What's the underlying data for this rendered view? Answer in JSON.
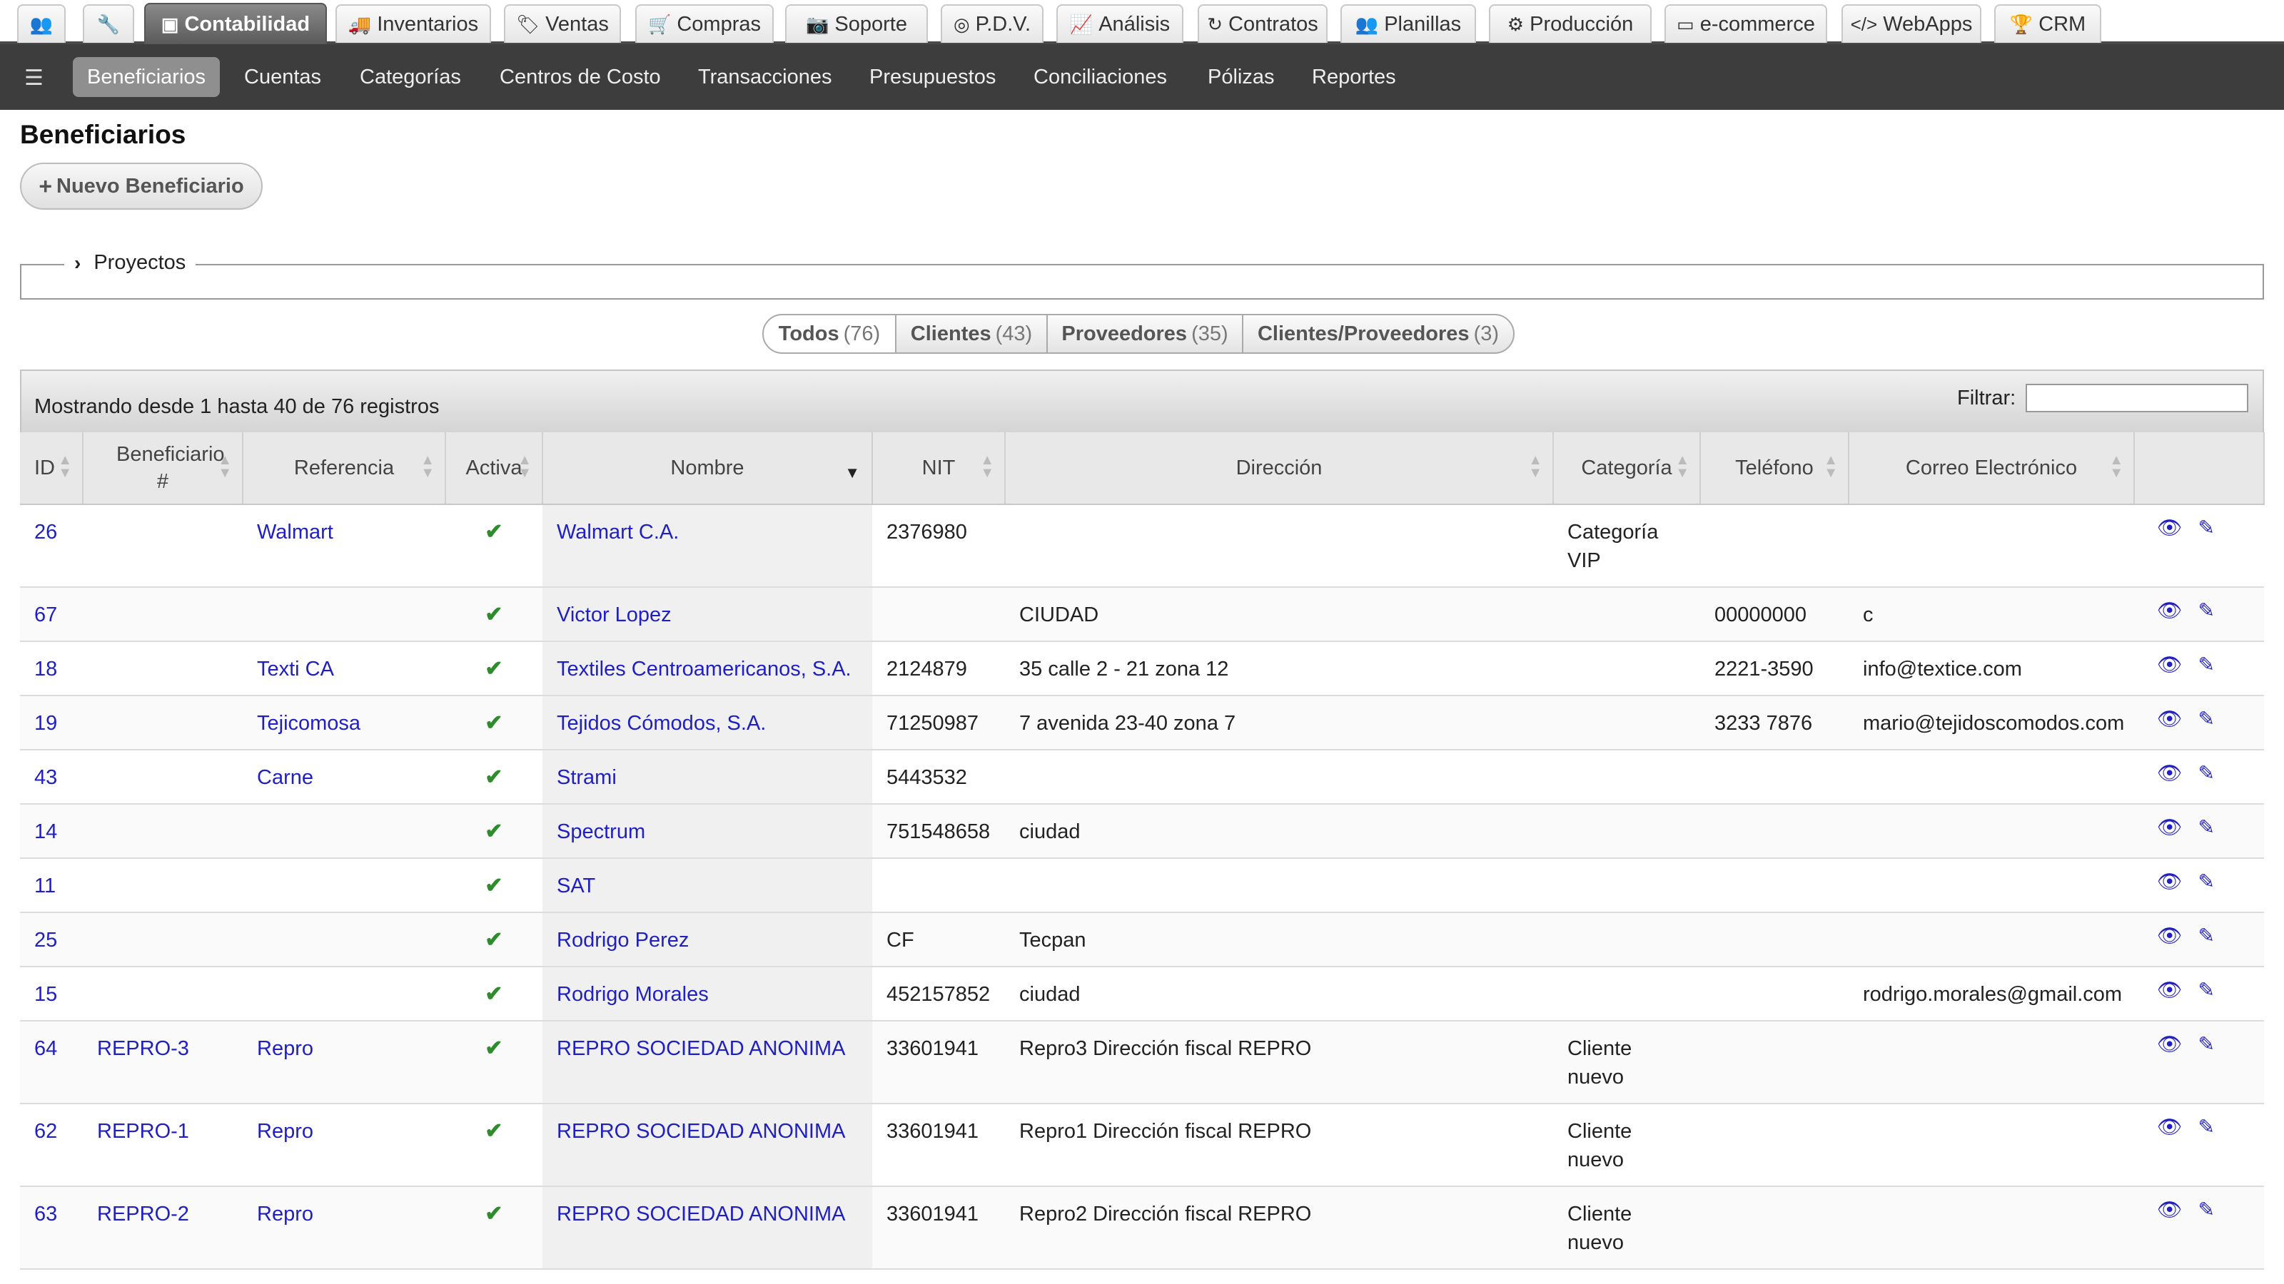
{
  "top_tabs": [
    {
      "icon": "users-icon",
      "glyph": "👥",
      "label": ""
    },
    {
      "icon": "wrench-icon",
      "glyph": "🔧",
      "label": ""
    },
    {
      "icon": "money-icon",
      "glyph": "▣",
      "label": "Contabilidad",
      "active": true
    },
    {
      "icon": "truck-icon",
      "glyph": "🚚",
      "label": "Inventarios"
    },
    {
      "icon": "tags-icon",
      "glyph": "🏷",
      "label": "Ventas"
    },
    {
      "icon": "cart-icon",
      "glyph": "🛒",
      "label": "Compras"
    },
    {
      "icon": "camera-icon",
      "glyph": "📷",
      "label": "Soporte"
    },
    {
      "icon": "target-icon",
      "glyph": "◎",
      "label": "P.D.V."
    },
    {
      "icon": "chart-line-icon",
      "glyph": "📈",
      "label": "Análisis"
    },
    {
      "icon": "refresh-icon",
      "glyph": "↻",
      "label": "Contratos"
    },
    {
      "icon": "users-icon",
      "glyph": "👥",
      "label": "Planillas"
    },
    {
      "icon": "cogs-icon",
      "glyph": "⚙",
      "label": "Producción"
    },
    {
      "icon": "card-icon",
      "glyph": "▭",
      "label": "e-commerce"
    },
    {
      "icon": "code-icon",
      "glyph": "</>",
      "label": "WebApps"
    },
    {
      "icon": "trophy-icon",
      "glyph": "🏆",
      "label": "CRM"
    }
  ],
  "sub_nav": {
    "toggle_icon": "sliders-icon",
    "items": [
      "Beneficiarios",
      "Cuentas",
      "Categorías",
      "Centros de Costo",
      "Transacciones",
      "Presupuestos",
      "Conciliaciones",
      "Pólizas",
      "Reportes"
    ],
    "active": "Beneficiarios"
  },
  "page": {
    "title": "Beneficiarios",
    "new_button": "Nuevo Beneficiario",
    "fieldset_legend": "Proyectos"
  },
  "filters": [
    {
      "label": "Todos",
      "count": "(76)"
    },
    {
      "label": "Clientes",
      "count": "(43)"
    },
    {
      "label": "Proveedores",
      "count": "(35)"
    },
    {
      "label": "Clientes/Proveedores",
      "count": "(3)"
    }
  ],
  "table": {
    "info": "Mostrando desde 1 hasta 40 de 76 registros",
    "filter_label": "Filtrar:",
    "filter_value": "",
    "columns": [
      "ID",
      "Beneficiario #",
      "Referencia",
      "Activa",
      "Nombre",
      "NIT",
      "Dirección",
      "Categoría",
      "Teléfono",
      "Correo Electrónico",
      ""
    ],
    "rows": [
      {
        "id": "26",
        "ben": "",
        "ref": "Walmart",
        "act": "✔",
        "nom": "Walmart C.A.",
        "nit": "2376980",
        "dir": "",
        "cat": "Categoría VIP",
        "tel": "",
        "mail": ""
      },
      {
        "id": "67",
        "ben": "",
        "ref": "",
        "act": "✔",
        "nom": "Victor Lopez",
        "nit": "",
        "dir": "CIUDAD",
        "cat": "",
        "tel": "00000000",
        "mail": "c"
      },
      {
        "id": "18",
        "ben": "",
        "ref": "Texti CA",
        "act": "✔",
        "nom": "Textiles Centroamericanos, S.A.",
        "nit": "2124879",
        "dir": "35 calle 2 - 21 zona 12",
        "cat": "",
        "tel": "2221-3590",
        "mail": "info@textice.com"
      },
      {
        "id": "19",
        "ben": "",
        "ref": "Tejicomosa",
        "act": "✔",
        "nom": "Tejidos Cómodos, S.A.",
        "nit": "71250987",
        "dir": "7 avenida 23-40 zona 7",
        "cat": "",
        "tel": "3233 7876",
        "mail": "mario@tejidoscomodos.com"
      },
      {
        "id": "43",
        "ben": "",
        "ref": "Carne",
        "act": "✔",
        "nom": "Strami",
        "nit": "5443532",
        "dir": "",
        "cat": "",
        "tel": "",
        "mail": ""
      },
      {
        "id": "14",
        "ben": "",
        "ref": "",
        "act": "✔",
        "nom": "Spectrum",
        "nit": "751548658",
        "dir": "ciudad",
        "cat": "",
        "tel": "",
        "mail": ""
      },
      {
        "id": "11",
        "ben": "",
        "ref": "",
        "act": "✔",
        "nom": "SAT",
        "nit": "",
        "dir": "",
        "cat": "",
        "tel": "",
        "mail": ""
      },
      {
        "id": "25",
        "ben": "",
        "ref": "",
        "act": "✔",
        "nom": "Rodrigo Perez",
        "nit": "CF",
        "dir": "Tecpan",
        "cat": "",
        "tel": "",
        "mail": ""
      },
      {
        "id": "15",
        "ben": "",
        "ref": "",
        "act": "✔",
        "nom": "Rodrigo Morales",
        "nit": "452157852",
        "dir": "ciudad",
        "cat": "",
        "tel": "",
        "mail": "rodrigo.morales@gmail.com"
      },
      {
        "id": "64",
        "ben": "REPRO-3",
        "ref": "Repro",
        "act": "✔",
        "nom": "REPRO SOCIEDAD ANONIMA",
        "nit": "33601941",
        "dir": "Repro3 Dirección fiscal REPRO",
        "cat": "Cliente nuevo",
        "tel": "",
        "mail": ""
      },
      {
        "id": "62",
        "ben": "REPRO-1",
        "ref": "Repro",
        "act": "✔",
        "nom": "REPRO SOCIEDAD ANONIMA",
        "nit": "33601941",
        "dir": "Repro1 Dirección fiscal REPRO",
        "cat": "Cliente nuevo",
        "tel": "",
        "mail": ""
      },
      {
        "id": "63",
        "ben": "REPRO-2",
        "ref": "Repro",
        "act": "✔",
        "nom": "REPRO SOCIEDAD ANONIMA",
        "nit": "33601941",
        "dir": "Repro2 Dirección fiscal REPRO",
        "cat": "Cliente nuevo",
        "tel": "",
        "mail": ""
      }
    ]
  },
  "colors": {
    "link": "#1f1fc4",
    "check": "#2e8b2e",
    "subnav": "#3d3d3d"
  }
}
